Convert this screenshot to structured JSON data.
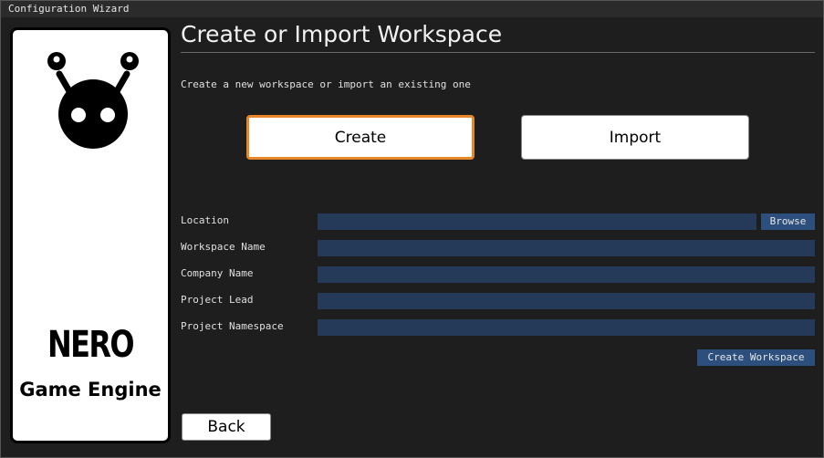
{
  "window": {
    "title": "Configuration Wizard"
  },
  "branding": {
    "name": "NERO",
    "tagline": "Game Engine",
    "logo_icon": "nero-robot-logo-icon"
  },
  "header": {
    "title": "Create or Import Workspace",
    "subtitle": "Create a new workspace or import an existing one"
  },
  "mode": {
    "create_label": "Create",
    "import_label": "Import",
    "selected": "Create",
    "accent_color": "#e8872a"
  },
  "form": {
    "location_label": "Location",
    "location_value": "",
    "browse_label": "Browse",
    "workspace_name_label": "Workspace Name",
    "workspace_name_value": "",
    "company_name_label": "Company Name",
    "company_name_value": "",
    "project_lead_label": "Project Lead",
    "project_lead_value": "",
    "project_namespace_label": "Project Namespace",
    "project_namespace_value": "",
    "submit_label": "Create Workspace",
    "input_color": "#243a58",
    "button_color": "#2c4f7e"
  },
  "footer": {
    "back_label": "Back"
  }
}
